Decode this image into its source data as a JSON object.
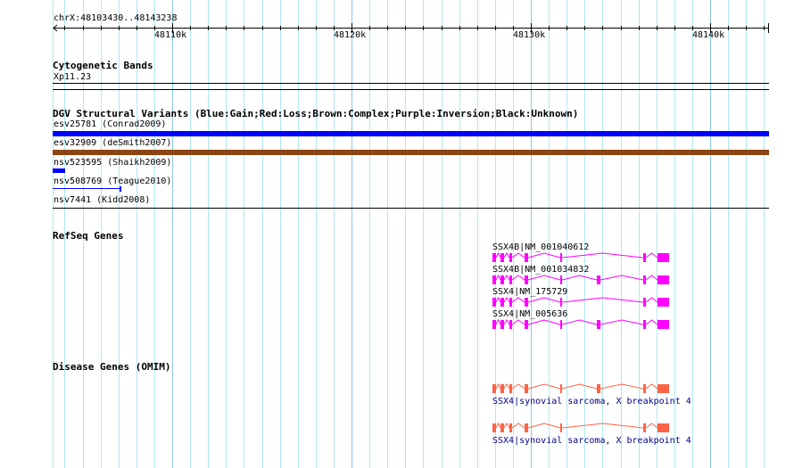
{
  "ruler": {
    "region": "chrX:48103430..48143238",
    "start": 48103430,
    "end": 48143238,
    "ticks": [
      "48110k",
      "48120k",
      "48130k",
      "48140k"
    ]
  },
  "cytobands": {
    "title": "Cytogenetic Bands",
    "band": "Xp11.23"
  },
  "dgv": {
    "title": "DGV Structural Variants (Blue:Gain;Red:Loss;Brown:Complex;Purple:Inversion;Black:Unknown)",
    "items": [
      {
        "label": "esv25781 (Conrad2009)",
        "color": "#0000ff"
      },
      {
        "label": "esv32909 (deSmith2007)",
        "color": "#8b4513"
      },
      {
        "label": "nsv523595 (Shaikh2009)",
        "color": "#0000ff"
      },
      {
        "label": "nsv508769 (Teague2010)",
        "color": "#0000ff"
      },
      {
        "label": "nsv7441 (Kidd2008)",
        "color": "#000000"
      }
    ]
  },
  "refseq": {
    "title": "RefSeq Genes",
    "color": "#ff00ff",
    "genes": [
      {
        "label": "SSX4B|NM_001040612"
      },
      {
        "label": "SSX4B|NM_001034832"
      },
      {
        "label": "SSX4|NM_175729"
      },
      {
        "label": "SSX4|NM_005636"
      }
    ]
  },
  "omim": {
    "title": "Disease Genes (OMIM)",
    "color": "#ff6347",
    "genes": [
      {
        "label": "SSX4|synovial sarcoma, X breakpoint 4"
      },
      {
        "label": "SSX4|synovial sarcoma, X breakpoint 4"
      }
    ]
  }
}
